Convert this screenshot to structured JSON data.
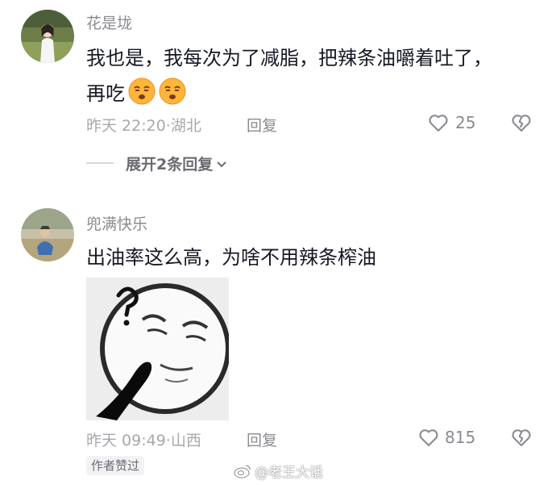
{
  "comments": [
    {
      "username": "花是垅",
      "text_line1": "我也是，我每次为了减脂，把辣条油嚼着吐了，",
      "text_line2": "再吃",
      "emojis": [
        "smirk-face-icon",
        "smirk-face-icon"
      ],
      "time": "昨天 22:20",
      "location": "湖北",
      "reply_label": "回复",
      "like_count": "25",
      "expand_label": "展开2条回复"
    },
    {
      "username": "兜满快乐",
      "text": "出油率这么高，为啥不用辣条榨油",
      "sticker": "thinking-meme-sticker",
      "time": "昨天 09:49",
      "location": "山西",
      "reply_label": "回复",
      "like_count": "815",
      "author_badge": "作者赞过"
    }
  ],
  "watermark": "@老王大话",
  "colors": {
    "text": "#161823",
    "meta": "#a7a8ad",
    "muted": "#8a8b91"
  }
}
